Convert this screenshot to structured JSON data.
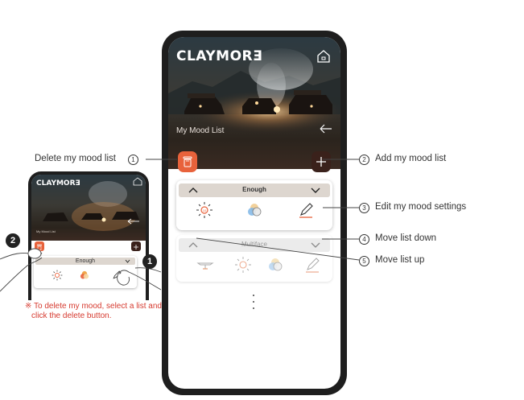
{
  "app": {
    "logo": "CLAYMORƎ",
    "small_logo": "CLAYMORƎ",
    "list_title": "My Mood List",
    "small_list_title": "My Mood List"
  },
  "cards": [
    {
      "title": "Enough",
      "state": "selected",
      "icons": [
        "brightness-icon",
        "color-mix-icon",
        "pencil-icon"
      ]
    },
    {
      "title": "Multiface",
      "state": "unselected",
      "icons": [
        "lamp-icon",
        "brightness-icon",
        "color-mix-icon",
        "pencil-icon"
      ]
    }
  ],
  "small_card": {
    "title": "Enough"
  },
  "annotations": {
    "delete": {
      "num": "1",
      "text": "Delete my mood list"
    },
    "add": {
      "num": "2",
      "text": "Add my mood list"
    },
    "edit": {
      "num": "3",
      "text": "Edit my mood settings"
    },
    "down": {
      "num": "4",
      "text": "Move list down"
    },
    "up": {
      "num": "5",
      "text": "Move list up"
    }
  },
  "steps": {
    "one": "1",
    "two": "2"
  },
  "note": {
    "line1": "※ To delete my mood, select a list and",
    "line2": "click the delete button."
  },
  "colors": {
    "accent": "#e8623b",
    "dark_button": "#3a211b",
    "note": "#d63a2f",
    "card_header": "#ddd6cf"
  }
}
